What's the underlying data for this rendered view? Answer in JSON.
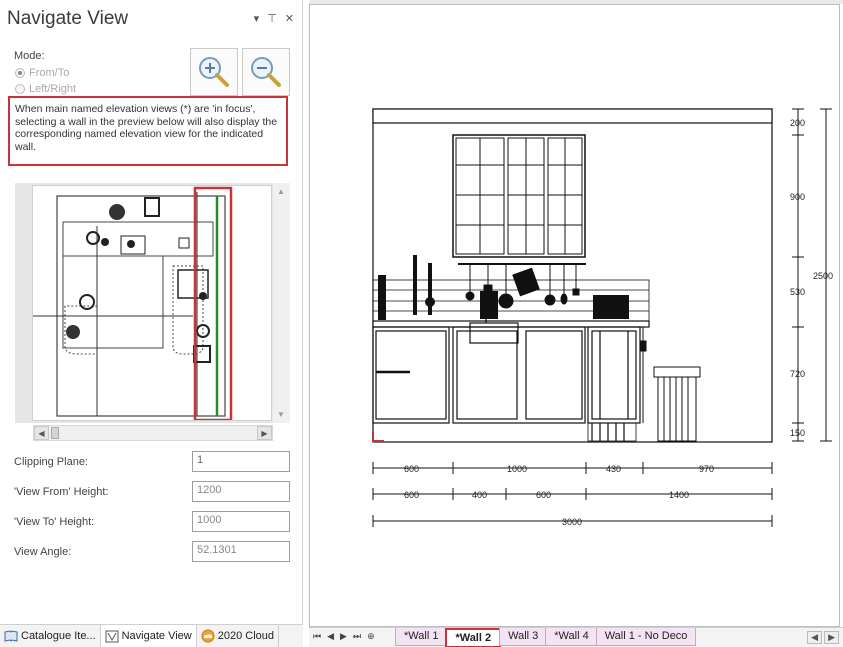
{
  "panel": {
    "title": "Navigate View",
    "btn_dropdown": "▾",
    "btn_pin": "⊤",
    "btn_close": "✕"
  },
  "mode": {
    "label": "Mode:",
    "option_from_to": "From/To",
    "option_left_right": "Left/Right",
    "selected": "From/To"
  },
  "zoom": {
    "zoom_in_icon": "zoom-in-icon",
    "zoom_out_icon": "zoom-out-icon"
  },
  "info_text": "When main named elevation views (*) are 'in focus', selecting a wall in the preview below will also display the corresponding named elevation view for the indicated wall.",
  "fields": {
    "clipping_plane_label": "Clipping Plane:",
    "clipping_plane_value": "1",
    "view_from_label": "'View From' Height:",
    "view_from_value": "1200",
    "view_to_label": "'View To' Height:",
    "view_to_value": "1000",
    "view_angle_label": "View Angle:",
    "view_angle_value": "52.1301"
  },
  "panel_tabs": [
    {
      "label": "Catalogue Ite...",
      "icon": "book-icon"
    },
    {
      "label": "Navigate View",
      "icon": "navigate-icon"
    },
    {
      "label": "2020 Cloud",
      "icon": "cloud-icon"
    }
  ],
  "dimensions": {
    "right": [
      "200",
      "900",
      "530",
      "720",
      "150"
    ],
    "total_height": "2500",
    "row1": [
      "600",
      "1000",
      "430",
      "970"
    ],
    "row2": [
      "600",
      "400",
      "600",
      "1400"
    ],
    "total_width": "3000"
  },
  "sheet_tabs": [
    {
      "label": "*Wall 1",
      "active": false
    },
    {
      "label": "*Wall 2",
      "active": true
    },
    {
      "label": "Wall 3",
      "active": false
    },
    {
      "label": "*Wall 4",
      "active": false
    },
    {
      "label": "Wall 1 - No Deco",
      "active": false
    }
  ],
  "colors": {
    "highlight": "#c8323a",
    "tab_bg": "#f4e3f2",
    "wall_line": "#2a8a2a"
  }
}
